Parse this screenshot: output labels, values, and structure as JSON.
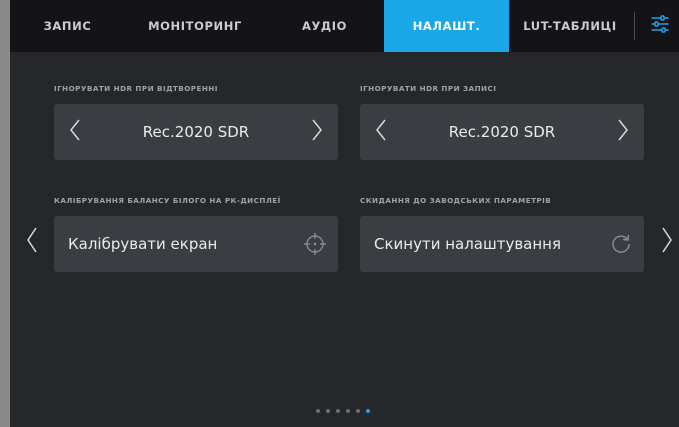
{
  "tabs": [
    {
      "label": "ЗАПИС",
      "active": false
    },
    {
      "label": "МОНІТОРИНГ",
      "active": false
    },
    {
      "label": "АУДІО",
      "active": false
    },
    {
      "label": "НАЛАШТ.",
      "active": true
    },
    {
      "label": "LUT-ТАБЛИЦІ",
      "active": false
    }
  ],
  "settings_icon": "sliders-icon",
  "sections": {
    "hdr_playback": {
      "label": "ІГНОРУВАТИ HDR ПРИ ВІДТВОРЕННІ",
      "value": "Rec.2020 SDR"
    },
    "hdr_record": {
      "label": "ІГНОРУВАТИ HDR ПРИ ЗАПИСІ",
      "value": "Rec.2020 SDR"
    },
    "white_balance": {
      "label": "КАЛІБРУВАННЯ БАЛАНСУ БІЛОГО НА РК-ДИСПЛЕЇ",
      "button": "Калібрувати екран",
      "icon": "crosshair-icon"
    },
    "factory_reset": {
      "label": "СКИДАННЯ ДО ЗАВОДСЬКИХ ПАРАМЕТРІВ",
      "button": "Скинути налаштування",
      "icon": "reset-icon"
    }
  },
  "pagination": {
    "pages": 6,
    "current": 6
  },
  "colors": {
    "accent": "#1aa7e8",
    "background": "#26272a",
    "card": "#3b3d42"
  }
}
